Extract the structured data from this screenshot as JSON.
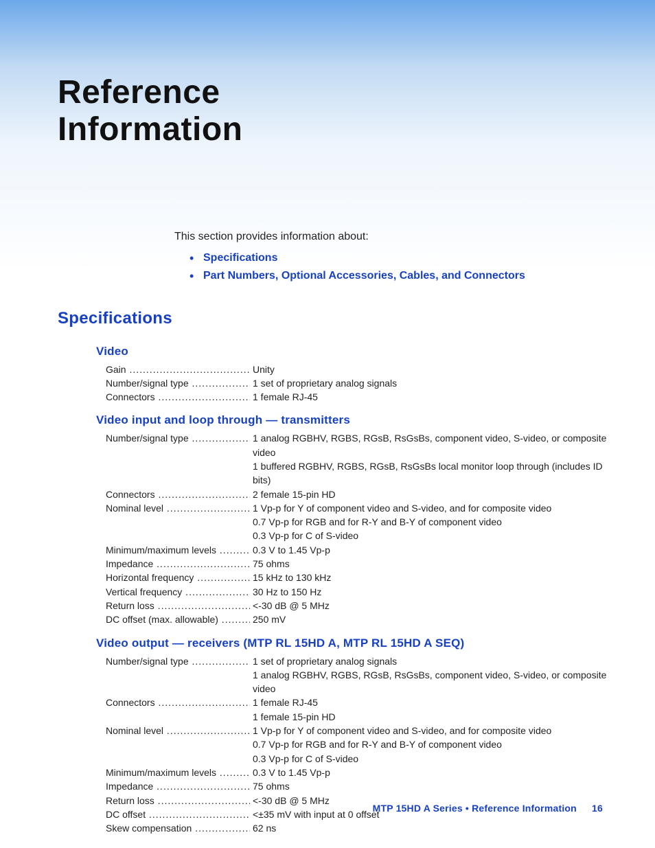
{
  "title_line1": "Reference",
  "title_line2": "Information",
  "intro_text": "This section provides information about:",
  "intro_links": [
    "Specifications",
    "Part Numbers, Optional Accessories, Cables, and Connectors"
  ],
  "section_heading": "Specifications",
  "groups": [
    {
      "heading": "Video",
      "rows": [
        {
          "label": "Gain",
          "values": [
            "Unity"
          ]
        },
        {
          "label": "Number/signal type",
          "values": [
            "1 set of proprietary analog signals"
          ]
        },
        {
          "label": "Connectors",
          "values": [
            "1 female RJ-45"
          ]
        }
      ]
    },
    {
      "heading": "Video input and loop through — transmitters",
      "rows": [
        {
          "label": "Number/signal type",
          "values": [
            "1 analog RGBHV, RGBS, RGsB, RsGsBs, component video, S-video, or composite video",
            "1 buffered RGBHV, RGBS, RGsB, RsGsBs local monitor loop through (includes ID bits)"
          ]
        },
        {
          "label": "Connectors",
          "values": [
            "2 female 15-pin HD"
          ]
        },
        {
          "label": "Nominal level",
          "values": [
            "1 Vp-p for Y of component video and S-video, and for composite video",
            "0.7 Vp-p for RGB and for R-Y and B-Y of component video",
            "0.3 Vp-p for C of S-video"
          ]
        },
        {
          "label": "Minimum/maximum levels",
          "values": [
            "0.3 V to 1.45 Vp-p"
          ]
        },
        {
          "label": "Impedance",
          "values": [
            "75 ohms"
          ]
        },
        {
          "label": "Horizontal frequency",
          "values": [
            "15 kHz to 130 kHz"
          ]
        },
        {
          "label": "Vertical frequency",
          "values": [
            "30 Hz to 150 Hz"
          ]
        },
        {
          "label": "Return loss",
          "values": [
            "<-30 dB @ 5 MHz"
          ]
        },
        {
          "label": "DC offset (max. allowable)",
          "values": [
            "250 mV"
          ]
        }
      ]
    },
    {
      "heading": "Video output — receivers (MTP RL 15HD A, MTP RL 15HD A SEQ)",
      "rows": [
        {
          "label": "Number/signal type",
          "values": [
            "1 set of proprietary analog signals",
            "1 analog RGBHV, RGBS, RGsB, RsGsBs, component video, S-video, or composite video"
          ]
        },
        {
          "label": "Connectors",
          "values": [
            "1 female RJ-45",
            "1 female 15-pin HD"
          ]
        },
        {
          "label": "Nominal level",
          "values": [
            "1 Vp-p for Y of component video and S-video, and for composite video",
            "0.7 Vp-p for RGB and for R-Y and B-Y of component video",
            "0.3 Vp-p for C of S-video"
          ]
        },
        {
          "label": "Minimum/maximum levels",
          "values": [
            "0.3 V to 1.45 Vp-p"
          ]
        },
        {
          "label": "Impedance",
          "values": [
            "75 ohms"
          ]
        },
        {
          "label": "Return loss",
          "values": [
            "<-30 dB @ 5 MHz"
          ]
        },
        {
          "label": "DC offset",
          "values": [
            "<±35 mV with input at 0 offset"
          ]
        },
        {
          "label": "Skew compensation",
          "values": [
            "62 ns"
          ]
        }
      ]
    }
  ],
  "footer_text": "MTP 15HD A Series • Reference Information",
  "page_number": "16"
}
